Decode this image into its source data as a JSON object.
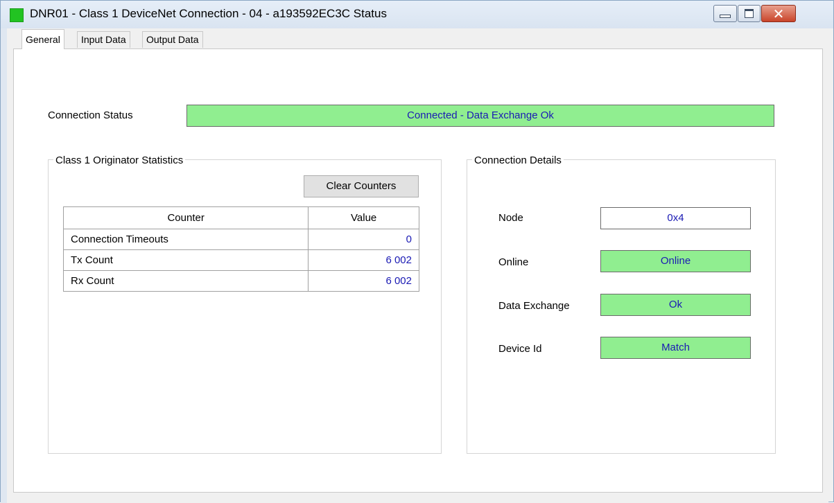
{
  "window": {
    "title": "DNR01 - Class 1 DeviceNet Connection - 04 - a193592EC3C Status",
    "controls": {
      "minimize": "minimize",
      "maximize": "maximize",
      "close": "✕"
    }
  },
  "tabs": [
    {
      "label": "General",
      "active": true
    },
    {
      "label": "Input Data",
      "active": false
    },
    {
      "label": "Output Data",
      "active": false
    }
  ],
  "general": {
    "connection_status_label": "Connection Status",
    "connection_status_value": "Connected - Data Exchange Ok",
    "status_color": "#90ee90",
    "value_color": "#1a1ab4"
  },
  "statistics": {
    "title": "Class 1 Originator Statistics",
    "clear_button": "Clear Counters",
    "columns": [
      "Counter",
      "Value"
    ],
    "rows": [
      {
        "counter": "Connection Timeouts",
        "value": "0"
      },
      {
        "counter": "Tx Count",
        "value": "6 002"
      },
      {
        "counter": "Rx Count",
        "value": "6 002"
      }
    ]
  },
  "details": {
    "title": "Connection Details",
    "node_label": "Node",
    "node_value": "0x4",
    "online_label": "Online",
    "online_value": "Online",
    "data_exchange_label": "Data Exchange",
    "data_exchange_value": "Ok",
    "device_id_label": "Device Id",
    "device_id_value": "Match"
  }
}
